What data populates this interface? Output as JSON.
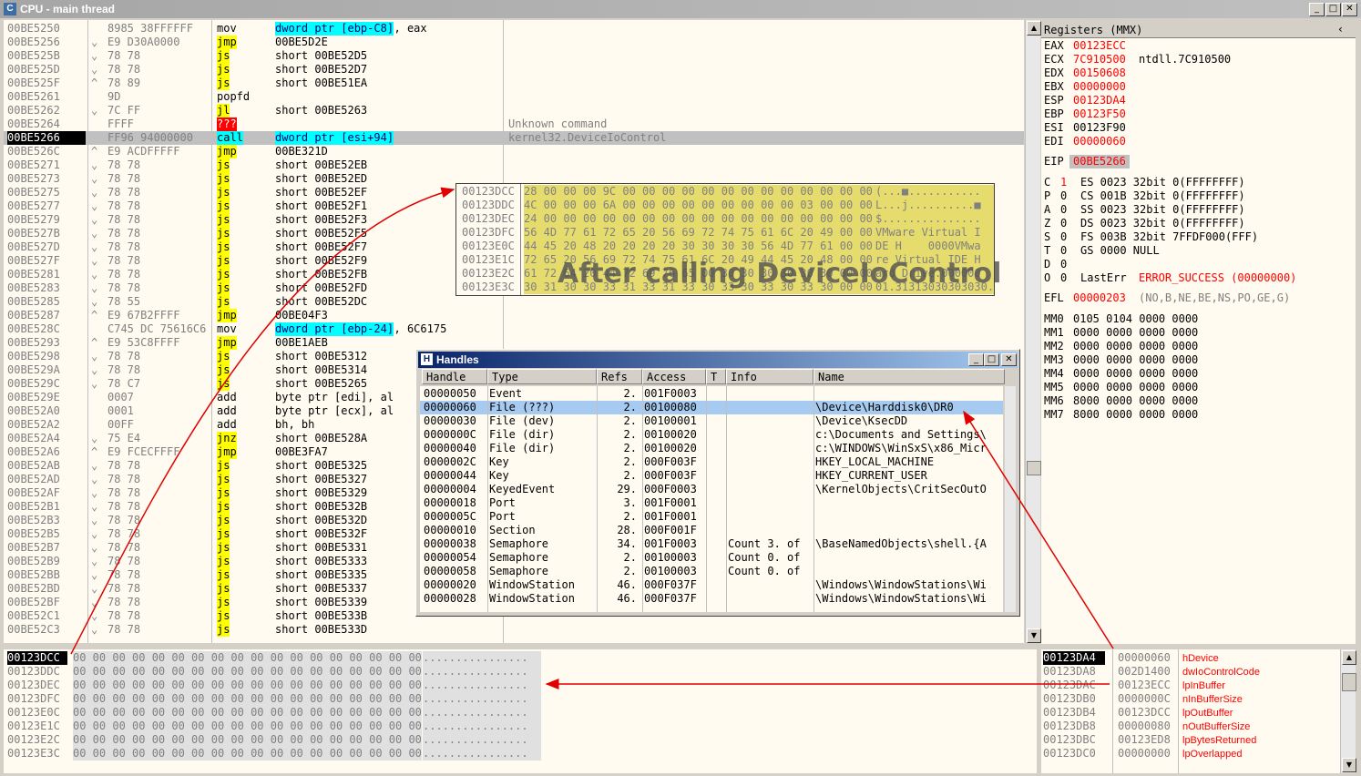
{
  "window": {
    "title": "CPU - main thread"
  },
  "disasm": [
    {
      "addr": "00BE5250",
      "mark": "",
      "hex": "8985 38FFFFFF",
      "mn": "mov",
      "op": "dword ptr [ebp-C8]",
      "op2": ", eax",
      "cm": "",
      "style": "dwcyan"
    },
    {
      "addr": "00BE5256",
      "mark": "⌄",
      "hex": "E9 D30A0000",
      "mn": "jmp",
      "op": "00BE5D2E",
      "op2": "",
      "cm": "",
      "style": "jmp"
    },
    {
      "addr": "00BE525B",
      "mark": "⌄",
      "hex": "78 78",
      "mn": "js",
      "op": "short 00BE52D5",
      "op2": "",
      "cm": "",
      "style": "jmp"
    },
    {
      "addr": "00BE525D",
      "mark": "⌄",
      "hex": "78 78",
      "mn": "js",
      "op": "short 00BE52D7",
      "op2": "",
      "cm": "",
      "style": "jmp"
    },
    {
      "addr": "00BE525F",
      "mark": "^",
      "hex": "78 89",
      "mn": "js",
      "op": "short 00BE51EA",
      "op2": "",
      "cm": "",
      "style": "jmp"
    },
    {
      "addr": "00BE5261",
      "mark": "",
      "hex": "9D",
      "mn": "popfd",
      "op": "",
      "op2": "",
      "cm": "",
      "style": ""
    },
    {
      "addr": "00BE5262",
      "mark": "⌄",
      "hex": "7C FF",
      "mn": "jl",
      "op": "short 00BE5263",
      "op2": "",
      "cm": "",
      "style": "jmp"
    },
    {
      "addr": "00BE5264",
      "mark": "",
      "hex": "FFFF",
      "mn": "???",
      "op": "",
      "op2": "",
      "cm": "Unknown command",
      "style": "bad"
    },
    {
      "addr": "00BE5266",
      "mark": "",
      "hex": "FF96 94000000",
      "mn": "call",
      "op": "dword ptr [esi+94]",
      "op2": "",
      "cm": "kernel32.DeviceIoControl",
      "style": "call"
    },
    {
      "addr": "00BE526C",
      "mark": "^",
      "hex": "E9 ACDFFFFF",
      "mn": "jmp",
      "op": "00BE321D",
      "op2": "",
      "cm": "",
      "style": "jmp"
    },
    {
      "addr": "00BE5271",
      "mark": "⌄",
      "hex": "78 78",
      "mn": "js",
      "op": "short 00BE52EB",
      "op2": "",
      "cm": "",
      "style": "jmp"
    },
    {
      "addr": "00BE5273",
      "mark": "⌄",
      "hex": "78 78",
      "mn": "js",
      "op": "short 00BE52ED",
      "op2": "",
      "cm": "",
      "style": "jmp"
    },
    {
      "addr": "00BE5275",
      "mark": "⌄",
      "hex": "78 78",
      "mn": "js",
      "op": "short 00BE52EF",
      "op2": "",
      "cm": "",
      "style": "jmp"
    },
    {
      "addr": "00BE5277",
      "mark": "⌄",
      "hex": "78 78",
      "mn": "js",
      "op": "short 00BE52F1",
      "op2": "",
      "cm": "",
      "style": "jmp"
    },
    {
      "addr": "00BE5279",
      "mark": "⌄",
      "hex": "78 78",
      "mn": "js",
      "op": "short 00BE52F3",
      "op2": "",
      "cm": "",
      "style": "jmp"
    },
    {
      "addr": "00BE527B",
      "mark": "⌄",
      "hex": "78 78",
      "mn": "js",
      "op": "short 00BE52F5",
      "op2": "",
      "cm": "",
      "style": "jmp"
    },
    {
      "addr": "00BE527D",
      "mark": "⌄",
      "hex": "78 78",
      "mn": "js",
      "op": "short 00BE52F7",
      "op2": "",
      "cm": "",
      "style": "jmp"
    },
    {
      "addr": "00BE527F",
      "mark": "⌄",
      "hex": "78 78",
      "mn": "js",
      "op": "short 00BE52F9",
      "op2": "",
      "cm": "",
      "style": "jmp"
    },
    {
      "addr": "00BE5281",
      "mark": "⌄",
      "hex": "78 78",
      "mn": "js",
      "op": "short 00BE52FB",
      "op2": "",
      "cm": "",
      "style": "jmp"
    },
    {
      "addr": "00BE5283",
      "mark": "⌄",
      "hex": "78 78",
      "mn": "js",
      "op": "short 00BE52FD",
      "op2": "",
      "cm": "",
      "style": "jmp"
    },
    {
      "addr": "00BE5285",
      "mark": "⌄",
      "hex": "78 55",
      "mn": "js",
      "op": "short 00BE52DC",
      "op2": "",
      "cm": "",
      "style": "jmp"
    },
    {
      "addr": "00BE5287",
      "mark": "^",
      "hex": "E9 67B2FFFF",
      "mn": "jmp",
      "op": "00BE04F3",
      "op2": "",
      "cm": "",
      "style": "jmp"
    },
    {
      "addr": "00BE528C",
      "mark": "",
      "hex": "C745 DC 75616C6",
      "mn": "mov",
      "op": "dword ptr [ebp-24]",
      "op2": ", 6C6175",
      "cm": "",
      "style": "dwcyan"
    },
    {
      "addr": "00BE5293",
      "mark": "^",
      "hex": "E9 53C8FFFF",
      "mn": "jmp",
      "op": "00BE1AEB",
      "op2": "",
      "cm": "",
      "style": "jmp"
    },
    {
      "addr": "00BE5298",
      "mark": "⌄",
      "hex": "78 78",
      "mn": "js",
      "op": "short 00BE5312",
      "op2": "",
      "cm": "",
      "style": "jmp"
    },
    {
      "addr": "00BE529A",
      "mark": "⌄",
      "hex": "78 78",
      "mn": "js",
      "op": "short 00BE5314",
      "op2": "",
      "cm": "",
      "style": "jmp"
    },
    {
      "addr": "00BE529C",
      "mark": "⌄",
      "hex": "78 C7",
      "mn": "js",
      "op": "short 00BE5265",
      "op2": "",
      "cm": "",
      "style": "jmp"
    },
    {
      "addr": "00BE529E",
      "mark": "",
      "hex": "0007",
      "mn": "add",
      "op": "byte ptr [edi], al",
      "op2": "",
      "cm": "",
      "style": ""
    },
    {
      "addr": "00BE52A0",
      "mark": "",
      "hex": "0001",
      "mn": "add",
      "op": "byte ptr [ecx], al",
      "op2": "",
      "cm": "",
      "style": ""
    },
    {
      "addr": "00BE52A2",
      "mark": "",
      "hex": "00FF",
      "mn": "add",
      "op": "bh, bh",
      "op2": "",
      "cm": "",
      "style": ""
    },
    {
      "addr": "00BE52A4",
      "mark": "⌄",
      "hex": "75 E4",
      "mn": "jnz",
      "op": "short 00BE528A",
      "op2": "",
      "cm": "",
      "style": "jmp"
    },
    {
      "addr": "00BE52A6",
      "mark": "^",
      "hex": "E9 FCECFFFF",
      "mn": "jmp",
      "op": "00BE3FA7",
      "op2": "",
      "cm": "",
      "style": "jmp"
    },
    {
      "addr": "00BE52AB",
      "mark": "⌄",
      "hex": "78 78",
      "mn": "js",
      "op": "short 00BE5325",
      "op2": "",
      "cm": "",
      "style": "jmp"
    },
    {
      "addr": "00BE52AD",
      "mark": "⌄",
      "hex": "78 78",
      "mn": "js",
      "op": "short 00BE5327",
      "op2": "",
      "cm": "",
      "style": "jmp"
    },
    {
      "addr": "00BE52AF",
      "mark": "⌄",
      "hex": "78 78",
      "mn": "js",
      "op": "short 00BE5329",
      "op2": "",
      "cm": "",
      "style": "jmp"
    },
    {
      "addr": "00BE52B1",
      "mark": "⌄",
      "hex": "78 78",
      "mn": "js",
      "op": "short 00BE532B",
      "op2": "",
      "cm": "",
      "style": "jmp"
    },
    {
      "addr": "00BE52B3",
      "mark": "⌄",
      "hex": "78 78",
      "mn": "js",
      "op": "short 00BE532D",
      "op2": "",
      "cm": "",
      "style": "jmp"
    },
    {
      "addr": "00BE52B5",
      "mark": "⌄",
      "hex": "78 78",
      "mn": "js",
      "op": "short 00BE532F",
      "op2": "",
      "cm": "",
      "style": "jmp"
    },
    {
      "addr": "00BE52B7",
      "mark": "⌄",
      "hex": "78 78",
      "mn": "js",
      "op": "short 00BE5331",
      "op2": "",
      "cm": "",
      "style": "jmp"
    },
    {
      "addr": "00BE52B9",
      "mark": "⌄",
      "hex": "78 78",
      "mn": "js",
      "op": "short 00BE5333",
      "op2": "",
      "cm": "",
      "style": "jmp"
    },
    {
      "addr": "00BE52BB",
      "mark": "⌄",
      "hex": "78 78",
      "mn": "js",
      "op": "short 00BE5335",
      "op2": "",
      "cm": "",
      "style": "jmp"
    },
    {
      "addr": "00BE52BD",
      "mark": "⌄",
      "hex": "78 78",
      "mn": "js",
      "op": "short 00BE5337",
      "op2": "",
      "cm": "",
      "style": "jmp"
    },
    {
      "addr": "00BE52BF",
      "mark": "⌄",
      "hex": "78 78",
      "mn": "js",
      "op": "short 00BE5339",
      "op2": "",
      "cm": "",
      "style": "jmp"
    },
    {
      "addr": "00BE52C1",
      "mark": "⌄",
      "hex": "78 78",
      "mn": "js",
      "op": "short 00BE533B",
      "op2": "",
      "cm": "",
      "style": "jmp"
    },
    {
      "addr": "00BE52C3",
      "mark": "⌄",
      "hex": "78 78",
      "mn": "js",
      "op": "short 00BE533D",
      "op2": "",
      "cm": "",
      "style": "jmp"
    }
  ],
  "registers": {
    "title": "Registers (MMX)",
    "gp": [
      {
        "n": "EAX",
        "v": "00123ECC",
        "c": ""
      },
      {
        "n": "ECX",
        "v": "7C910500",
        "c": "ntdll.7C910500"
      },
      {
        "n": "EDX",
        "v": "00150608",
        "c": ""
      },
      {
        "n": "EBX",
        "v": "00000000",
        "c": ""
      },
      {
        "n": "ESP",
        "v": "00123DA4",
        "c": ""
      },
      {
        "n": "EBP",
        "v": "00123F50",
        "c": ""
      },
      {
        "n": "ESI",
        "v": "00123F90",
        "c": "",
        "black": true
      },
      {
        "n": "EDI",
        "v": "00000060",
        "c": ""
      }
    ],
    "eip": {
      "n": "EIP",
      "v": "00BE5266"
    },
    "flags": [
      {
        "f": "C",
        "b": "1",
        "seg": "ES 0023 32bit 0(FFFFFFFF)",
        "red": true
      },
      {
        "f": "P",
        "b": "0",
        "seg": "CS 001B 32bit 0(FFFFFFFF)"
      },
      {
        "f": "A",
        "b": "0",
        "seg": "SS 0023 32bit 0(FFFFFFFF)"
      },
      {
        "f": "Z",
        "b": "0",
        "seg": "DS 0023 32bit 0(FFFFFFFF)"
      },
      {
        "f": "S",
        "b": "0",
        "seg": "FS 003B 32bit 7FFDF000(FFF)"
      },
      {
        "f": "T",
        "b": "0",
        "seg": "GS 0000 NULL"
      },
      {
        "f": "D",
        "b": "0",
        "seg": ""
      },
      {
        "f": "O",
        "b": "0",
        "seg": ""
      }
    ],
    "lasterr_label": "LastErr",
    "lasterr_value": "ERROR_SUCCESS (00000000)",
    "efl_label": "EFL",
    "efl_value": "00000203",
    "efl_desc": "(NO,B,NE,BE,NS,PO,GE,G)",
    "mmx": [
      {
        "n": "MM0",
        "v": "0105 0104 0000 0000"
      },
      {
        "n": "MM1",
        "v": "0000 0000 0000 0000"
      },
      {
        "n": "MM2",
        "v": "0000 0000 0000 0000"
      },
      {
        "n": "MM3",
        "v": "0000 0000 0000 0000"
      },
      {
        "n": "MM4",
        "v": "0000 0000 0000 0000"
      },
      {
        "n": "MM5",
        "v": "0000 0000 0000 0000"
      },
      {
        "n": "MM6",
        "v": "8000 0000 0000 0000"
      },
      {
        "n": "MM7",
        "v": "8000 0000 0000 0000"
      }
    ]
  },
  "dump_before": {
    "rows": [
      {
        "addr": "00123DCC",
        "hex": "00 00 00 00 00 00 00 00 00 00 00 00 00 00 00 00 00 00",
        "asc": "................"
      },
      {
        "addr": "00123DDC",
        "hex": "00 00 00 00 00 00 00 00 00 00 00 00 00 00 00 00 00 00",
        "asc": "................"
      },
      {
        "addr": "00123DEC",
        "hex": "00 00 00 00 00 00 00 00 00 00 00 00 00 00 00 00 00 00",
        "asc": "................"
      },
      {
        "addr": "00123DFC",
        "hex": "00 00 00 00 00 00 00 00 00 00 00 00 00 00 00 00 00 00",
        "asc": "................"
      },
      {
        "addr": "00123E0C",
        "hex": "00 00 00 00 00 00 00 00 00 00 00 00 00 00 00 00 00 00",
        "asc": "................"
      },
      {
        "addr": "00123E1C",
        "hex": "00 00 00 00 00 00 00 00 00 00 00 00 00 00 00 00 00 00",
        "asc": "................"
      },
      {
        "addr": "00123E2C",
        "hex": "00 00 00 00 00 00 00 00 00 00 00 00 00 00 00 00 00 00",
        "asc": "................"
      },
      {
        "addr": "00123E3C",
        "hex": "00 00 00 00 00 00 00 00 00 00 00 00 00 00 00 00 00 00",
        "asc": "................"
      }
    ]
  },
  "dump_after": {
    "rows": [
      {
        "addr": "00123DCC",
        "hex": "28 00 00 00 9C 00 00 00 00 00 00 00 00 00 00 00 00 00",
        "asc": "(...■..........."
      },
      {
        "addr": "00123DDC",
        "hex": "4C 00 00 00 6A 00 00 00 00 00 00 00 00 00 03 00 00 00",
        "asc": "L...j..........■"
      },
      {
        "addr": "00123DEC",
        "hex": "24 00 00 00 00 00 00 00 00 00 00 00 00 00 00 00 00 00",
        "asc": "$..............."
      },
      {
        "addr": "00123DFC",
        "hex": "56 4D 77 61 72 65 20 56 69 72 74 75 61 6C 20 49 00 00",
        "asc": "VMware Virtual I"
      },
      {
        "addr": "00123E0C",
        "hex": "44 45 20 48 20 20 20 20 30 30 30 30 56 4D 77 61 00 00",
        "asc": "DE H    0000VMwa"
      },
      {
        "addr": "00123E1C",
        "hex": "72 65 20 56 69 72 74 75 61 6C 20 49 44 45 20 48 00 00",
        "asc": "re Virtual IDE H"
      },
      {
        "addr": "00123E2C",
        "hex": "61 72 64 20 44 72 69 76 65 00 30 30 30 30 30 30 00 00",
        "asc": "ard Drive.000000"
      },
      {
        "addr": "00123E3C",
        "hex": "30 31 30 30 33 31 33 31 33 30 33 30 33 30 33 30 00 00",
        "asc": "01.31313030303030."
      }
    ]
  },
  "annotation": "After calling DeviceIoControl",
  "handles": {
    "title": "Handles",
    "columns": [
      "Handle",
      "Type",
      "Refs",
      "Access",
      "T",
      "Info",
      "Name"
    ],
    "rows": [
      {
        "h": "00000050",
        "type": "Event",
        "refs": "2.",
        "acc": "001F0003",
        "t": "",
        "info": "",
        "name": ""
      },
      {
        "h": "00000060",
        "type": "File (???)",
        "refs": "2.",
        "acc": "00100080",
        "t": "",
        "info": "",
        "name": "\\Device\\Harddisk0\\DR0",
        "sel": true
      },
      {
        "h": "00000030",
        "type": "File (dev)",
        "refs": "2.",
        "acc": "00100001",
        "t": "",
        "info": "",
        "name": "\\Device\\KsecDD"
      },
      {
        "h": "0000000C",
        "type": "File (dir)",
        "refs": "2.",
        "acc": "00100020",
        "t": "",
        "info": "",
        "name": "c:\\Documents and Settings\\"
      },
      {
        "h": "00000040",
        "type": "File (dir)",
        "refs": "2.",
        "acc": "00100020",
        "t": "",
        "info": "",
        "name": "c:\\WINDOWS\\WinSxS\\x86_Micr"
      },
      {
        "h": "0000002C",
        "type": "Key",
        "refs": "2.",
        "acc": "000F003F",
        "t": "",
        "info": "",
        "name": "HKEY_LOCAL_MACHINE"
      },
      {
        "h": "00000044",
        "type": "Key",
        "refs": "2.",
        "acc": "000F003F",
        "t": "",
        "info": "",
        "name": "HKEY_CURRENT_USER"
      },
      {
        "h": "00000004",
        "type": "KeyedEvent",
        "refs": "29.",
        "acc": "000F0003",
        "t": "",
        "info": "",
        "name": "\\KernelObjects\\CritSecOutO"
      },
      {
        "h": "00000018",
        "type": "Port",
        "refs": "3.",
        "acc": "001F0001",
        "t": "",
        "info": "",
        "name": ""
      },
      {
        "h": "0000005C",
        "type": "Port",
        "refs": "2.",
        "acc": "001F0001",
        "t": "",
        "info": "",
        "name": ""
      },
      {
        "h": "00000010",
        "type": "Section",
        "refs": "28.",
        "acc": "000F001F",
        "t": "",
        "info": "",
        "name": ""
      },
      {
        "h": "00000038",
        "type": "Semaphore",
        "refs": "34.",
        "acc": "001F0003",
        "t": "",
        "info": "Count 3. of",
        "name": "\\BaseNamedObjects\\shell.{A"
      },
      {
        "h": "00000054",
        "type": "Semaphore",
        "refs": "2.",
        "acc": "00100003",
        "t": "",
        "info": "Count 0. of",
        "name": ""
      },
      {
        "h": "00000058",
        "type": "Semaphore",
        "refs": "2.",
        "acc": "00100003",
        "t": "",
        "info": "Count 0. of",
        "name": ""
      },
      {
        "h": "00000020",
        "type": "WindowStation",
        "refs": "46.",
        "acc": "000F037F",
        "t": "",
        "info": "",
        "name": "\\Windows\\WindowStations\\Wi"
      },
      {
        "h": "00000028",
        "type": "WindowStation",
        "refs": "46.",
        "acc": "000F037F",
        "t": "",
        "info": "",
        "name": "\\Windows\\WindowStations\\Wi"
      }
    ]
  },
  "stack": [
    {
      "addr": "00123DA4",
      "val": "00000060",
      "cm": "hDevice",
      "sel": true
    },
    {
      "addr": "00123DA8",
      "val": "002D1400",
      "cm": "dwIoControlCode"
    },
    {
      "addr": "00123DAC",
      "val": "00123ECC",
      "cm": "lpInBuffer"
    },
    {
      "addr": "00123DB0",
      "val": "0000000C",
      "cm": "nInBufferSize"
    },
    {
      "addr": "00123DB4",
      "val": "00123DCC",
      "cm": "lpOutBuffer"
    },
    {
      "addr": "00123DB8",
      "val": "00000080",
      "cm": "nOutBufferSize"
    },
    {
      "addr": "00123DBC",
      "val": "00123ED8",
      "cm": "lpBytesReturned"
    },
    {
      "addr": "00123DC0",
      "val": "00000000",
      "cm": "lpOverlapped"
    }
  ]
}
